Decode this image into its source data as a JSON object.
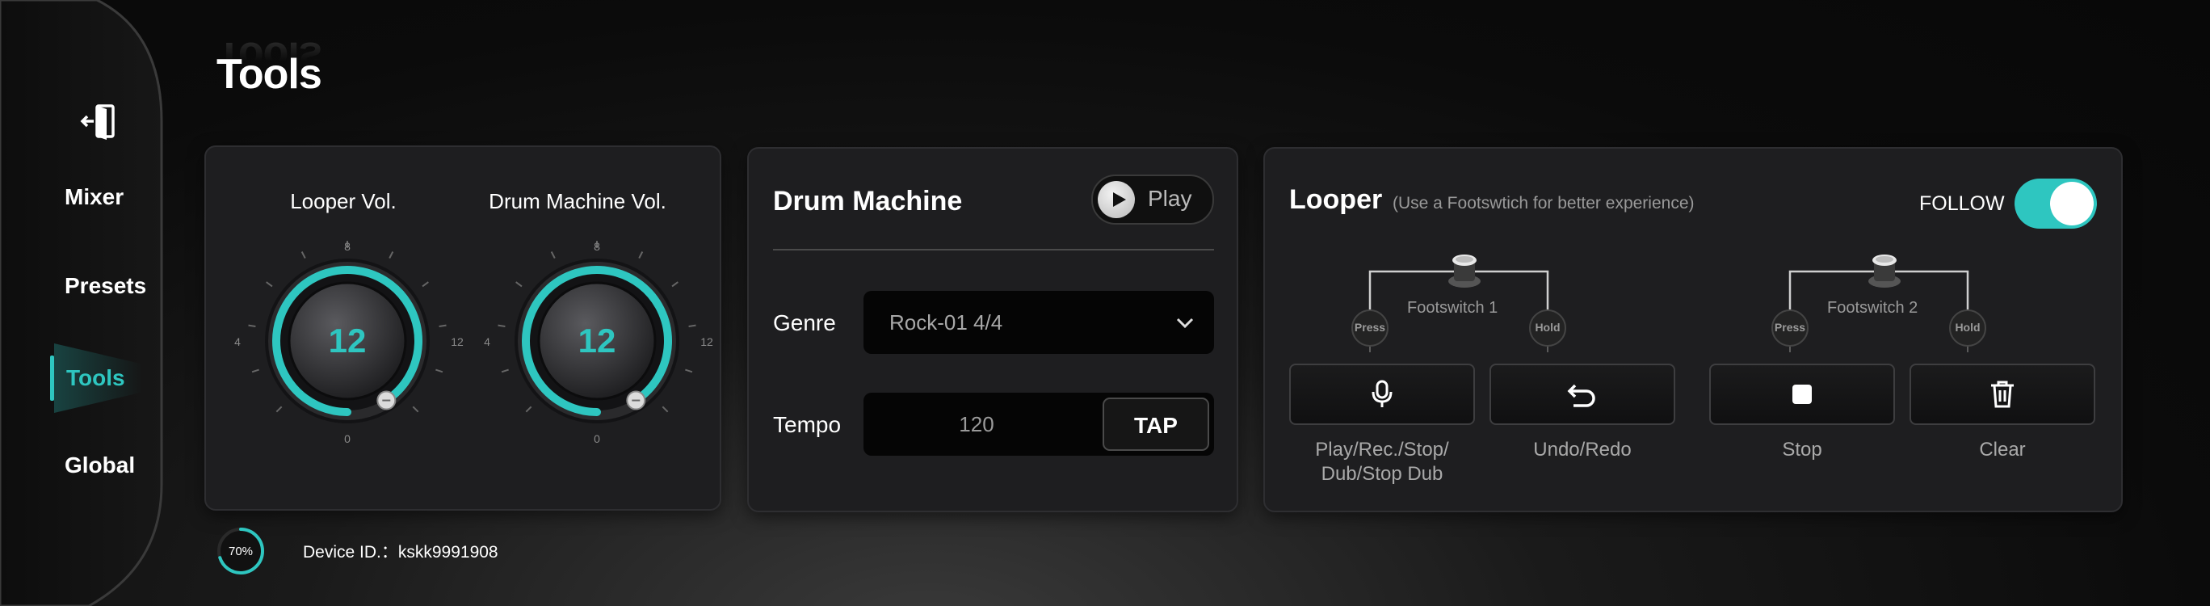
{
  "nav": {
    "exit_icon": "exit-door-icon",
    "items": [
      {
        "label": "Mixer",
        "active": false
      },
      {
        "label": "Presets",
        "active": false
      },
      {
        "label": "Tools",
        "active": true
      },
      {
        "label": "Global",
        "active": false
      }
    ],
    "accent": "#2ec6c0"
  },
  "page": {
    "title": "Tools"
  },
  "volumes": {
    "looper": {
      "label": "Looper Vol.",
      "value": "12",
      "level": 0.55
    },
    "drum": {
      "label": "Drum Machine Vol.",
      "value": "12",
      "level": 0.55
    },
    "scale": {
      "top": "8",
      "left": "4",
      "right": "12",
      "bottom": "0"
    }
  },
  "drum_machine": {
    "title": "Drum Machine",
    "play_label": "Play",
    "genre_label": "Genre",
    "genre_value": "Rock-01 4/4",
    "tempo_label": "Tempo",
    "tempo_value": "120",
    "tap_label": "TAP"
  },
  "looper": {
    "title": "Looper",
    "subtitle": "(Use a Footswtich for better experience)",
    "follow_label": "FOLLOW",
    "follow_on": true,
    "footswitch1": {
      "label": "Footswitch 1",
      "press": "Press",
      "hold": "Hold"
    },
    "footswitch2": {
      "label": "Footswitch 2",
      "press": "Press",
      "hold": "Hold"
    },
    "actions": [
      {
        "icon": "microphone-icon",
        "label_line1": "Play/Rec./Stop/",
        "label_line2": "Dub/Stop Dub"
      },
      {
        "icon": "undo-icon",
        "label_line1": "Undo/Redo"
      },
      {
        "icon": "stop-icon",
        "label_line1": "Stop"
      },
      {
        "icon": "trash-icon",
        "label_line1": "Clear"
      }
    ]
  },
  "status": {
    "progress_label": "70%",
    "progress": 0.7,
    "device_id": "Device ID.：kskk9991908"
  }
}
